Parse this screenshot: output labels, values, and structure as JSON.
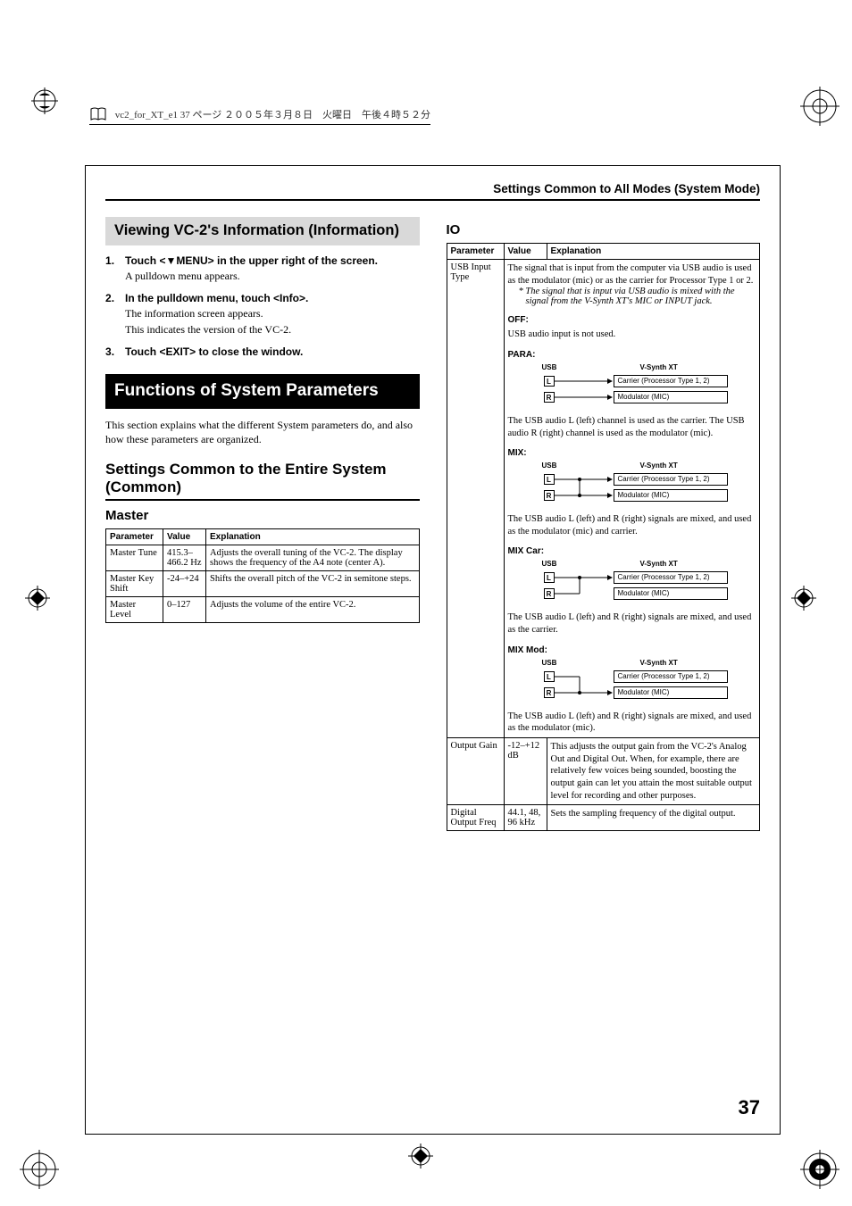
{
  "print_header": "vc2_for_XT_e1  37 ページ  ２００５年３月８日　火曜日　午後４時５２分",
  "top_title": "Settings Common to All Modes (System Mode)",
  "page_number": "37",
  "left": {
    "info_heading": "Viewing VC-2's Information (Information)",
    "steps": [
      {
        "title": "Touch <▼MENU> in the upper right of the screen.",
        "body": [
          "A pulldown menu appears."
        ]
      },
      {
        "title": "In the pulldown menu, touch <Info>.",
        "body": [
          "The information screen appears.",
          "This indicates the version of the VC-2."
        ]
      },
      {
        "title": "Touch <EXIT> to close the window.",
        "body": []
      }
    ],
    "func_heading": "Functions of System Parameters",
    "func_intro": "This section explains what the different System parameters do, and also how these parameters are organized.",
    "common_heading": "Settings Common to the Entire System (Common)",
    "master_heading": "Master",
    "master_table": {
      "headers": [
        "Parameter",
        "Value",
        "Explanation"
      ],
      "rows": [
        {
          "param": "Master Tune",
          "value": "415.3–466.2 Hz",
          "expl": "Adjusts the overall tuning of the VC-2. The display shows the frequency of the A4 note (center A)."
        },
        {
          "param": "Master Key Shift",
          "value": "-24–+24",
          "expl": "Shifts the overall pitch of the VC-2 in semitone steps."
        },
        {
          "param": "Master Level",
          "value": "0–127",
          "expl": "Adjusts the volume of the entire VC-2."
        }
      ]
    }
  },
  "right": {
    "io_heading": "IO",
    "io_headers": [
      "Parameter",
      "Value",
      "Explanation"
    ],
    "usb": {
      "param": "USB Input Type",
      "desc": "The signal that is input from the computer via USB audio is used as the modulator (mic) or as the carrier for Processor Type 1 or 2.",
      "note": "*  The signal that is input via USB audio is mixed with the signal from the V-Synth XT's MIC or INPUT jack.",
      "modes": [
        {
          "label": "OFF:",
          "caption": "USB audio input is not used.",
          "diagram": false
        },
        {
          "label": "PARA:",
          "caption": "The USB audio L (left) channel is used as the carrier. The USB audio R (right) channel is used as the modulator (mic).",
          "diagram": true,
          "type": "para"
        },
        {
          "label": "MIX:",
          "caption": "The USB audio L (left) and R (right) signals are mixed, and used as the modulator (mic) and carrier.",
          "diagram": true,
          "type": "mix"
        },
        {
          "label": "MIX Car:",
          "caption": "The USB audio L (left) and R (right) signals are mixed, and used as the carrier.",
          "diagram": true,
          "type": "mixcar"
        },
        {
          "label": "MIX Mod:",
          "caption": "The USB audio L (left) and R (right) signals are mixed, and used as the modulator (mic).",
          "diagram": true,
          "type": "mixmod"
        }
      ],
      "diag_labels": {
        "usb": "USB",
        "vs": "V-Synth XT",
        "l": "L",
        "r": "R",
        "carrier": "Carrier (Processor Type 1, 2)",
        "modulator": "Modulator (MIC)"
      }
    },
    "output_gain": {
      "param": "Output Gain",
      "value": "-12–+12 dB",
      "expl": "This adjusts the output gain from the VC-2's Analog Out and Digital Out. When, for example, there are relatively few voices being sounded, boosting the output gain can let you attain the most suitable output level for recording and other purposes."
    },
    "digital_out": {
      "param": "Digital Output Freq",
      "value": "44.1, 48, 96 kHz",
      "expl": "Sets the sampling frequency of the digital output."
    }
  }
}
